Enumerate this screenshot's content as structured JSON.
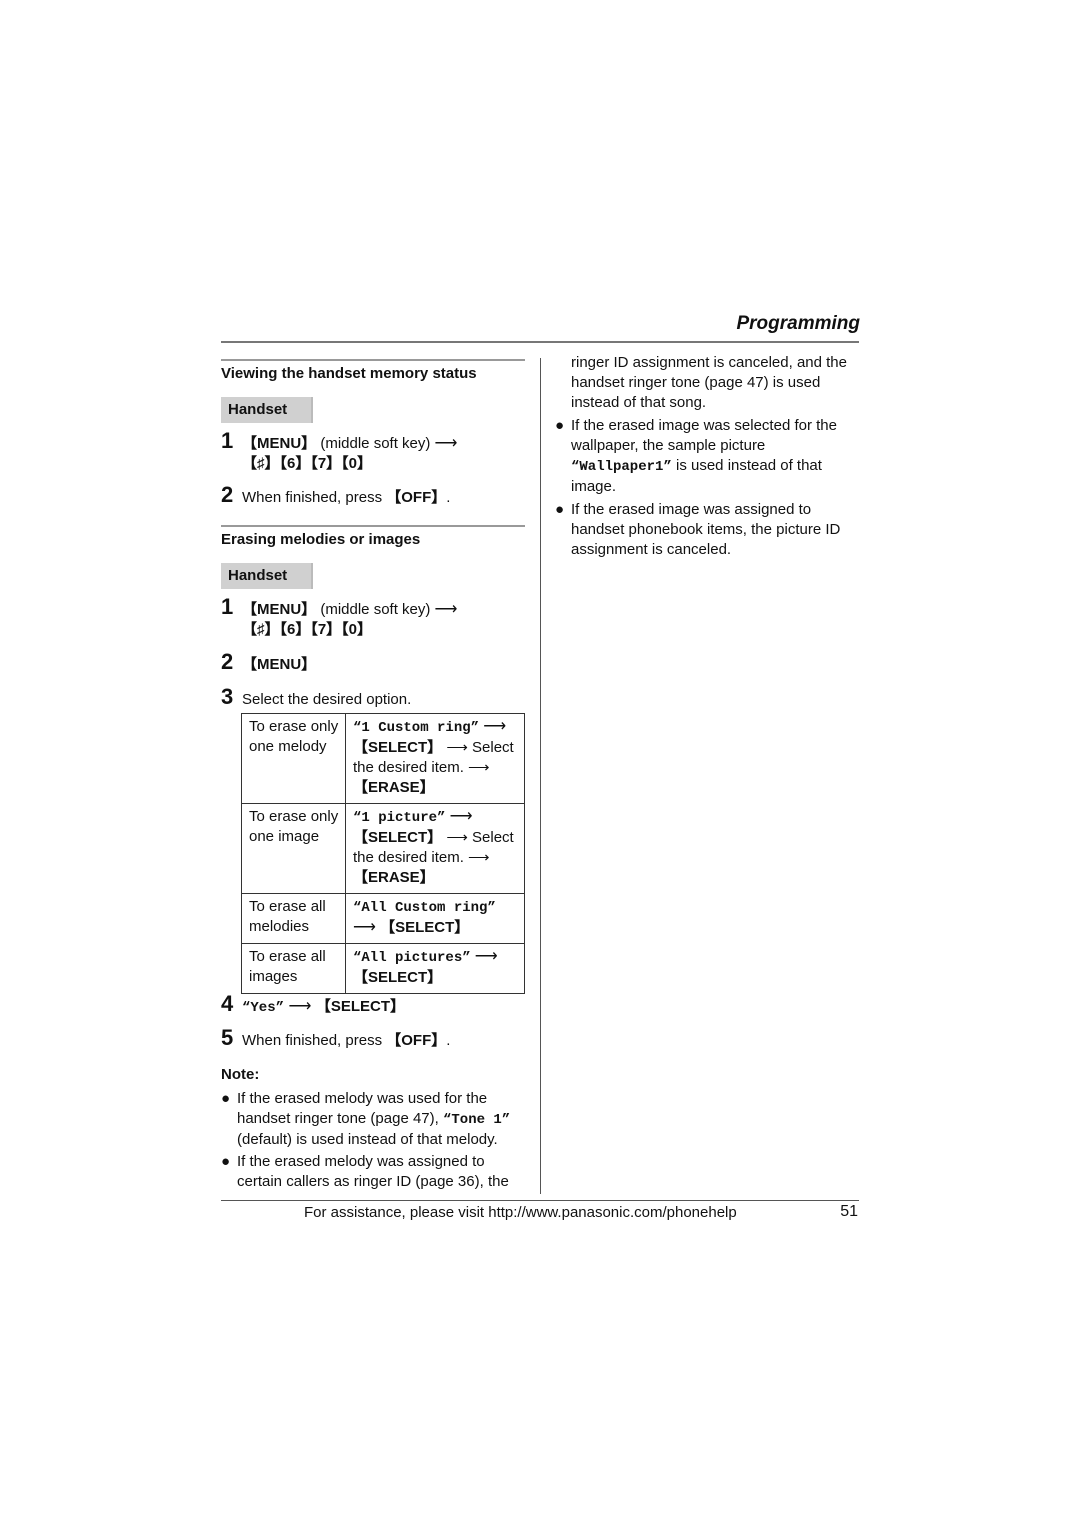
{
  "header": {
    "section_title": "Programming"
  },
  "left": {
    "section1": {
      "heading": "Viewing the handset memory status",
      "tag": "Handset",
      "steps": [
        {
          "num": "1",
          "key1": "【MENU】",
          "text1": " (middle soft key) ",
          "arrow": "⟶",
          "line2": "【♯】【6】【7】【0】"
        },
        {
          "num": "2",
          "text": "When finished, press ",
          "key": "【OFF】",
          "tail": "."
        }
      ]
    },
    "section2": {
      "heading": "Erasing melodies or images",
      "tag": "Handset",
      "steps": [
        {
          "num": "1",
          "key1": "【MENU】",
          "text1": " (middle soft key) ",
          "arrow": "⟶",
          "line2": "【♯】【6】【7】【0】"
        },
        {
          "num": "2",
          "key": "【MENU】"
        },
        {
          "num": "3",
          "text": "Select the desired option."
        },
        {
          "num": "4",
          "mono": "“Yes”",
          "arrow": " ⟶ ",
          "key": "【SELECT】"
        },
        {
          "num": "5",
          "text": "When finished, press ",
          "key": "【OFF】",
          "tail": "."
        }
      ],
      "table": [
        {
          "action": "To erase only one melody",
          "option": "“1 Custom ring”",
          "select": "【SELECT】",
          "then": " ⟶ Select the desired item. ⟶ ",
          "final": "【ERASE】"
        },
        {
          "action": "To erase only one image",
          "option": "“1 picture”",
          "select": "【SELECT】",
          "then": " ⟶ Select the desired item. ⟶ ",
          "final": "【ERASE】"
        },
        {
          "action": "To erase all melodies",
          "option": "“All Custom ring”",
          "select": "【SELECT】"
        },
        {
          "action": "To erase all images",
          "option": "“All pictures”",
          "select": "【SELECT】"
        }
      ]
    },
    "note": {
      "label": "Note:",
      "bullet1": {
        "a": "If the erased melody was used for the handset ringer tone (page 47), ",
        "mono": "“Tone 1”",
        "b": " (default) is used instead of that melody."
      },
      "bullet2": "If the erased melody was assigned to certain callers as ringer ID (page 36), the"
    }
  },
  "right": {
    "continuation": "ringer ID assignment is canceled, and the handset ringer tone (page 47) is used instead of that song.",
    "bullet1": {
      "a": "If the erased image was selected for the wallpaper, the sample picture ",
      "mono": "“Wallpaper1”",
      "b": " is used instead of that image."
    },
    "bullet2": "If the erased image was assigned to handset phonebook items, the picture ID assignment is canceled."
  },
  "footer": {
    "text": "For assistance, please visit http://www.panasonic.com/phonehelp",
    "page_number": "51"
  }
}
